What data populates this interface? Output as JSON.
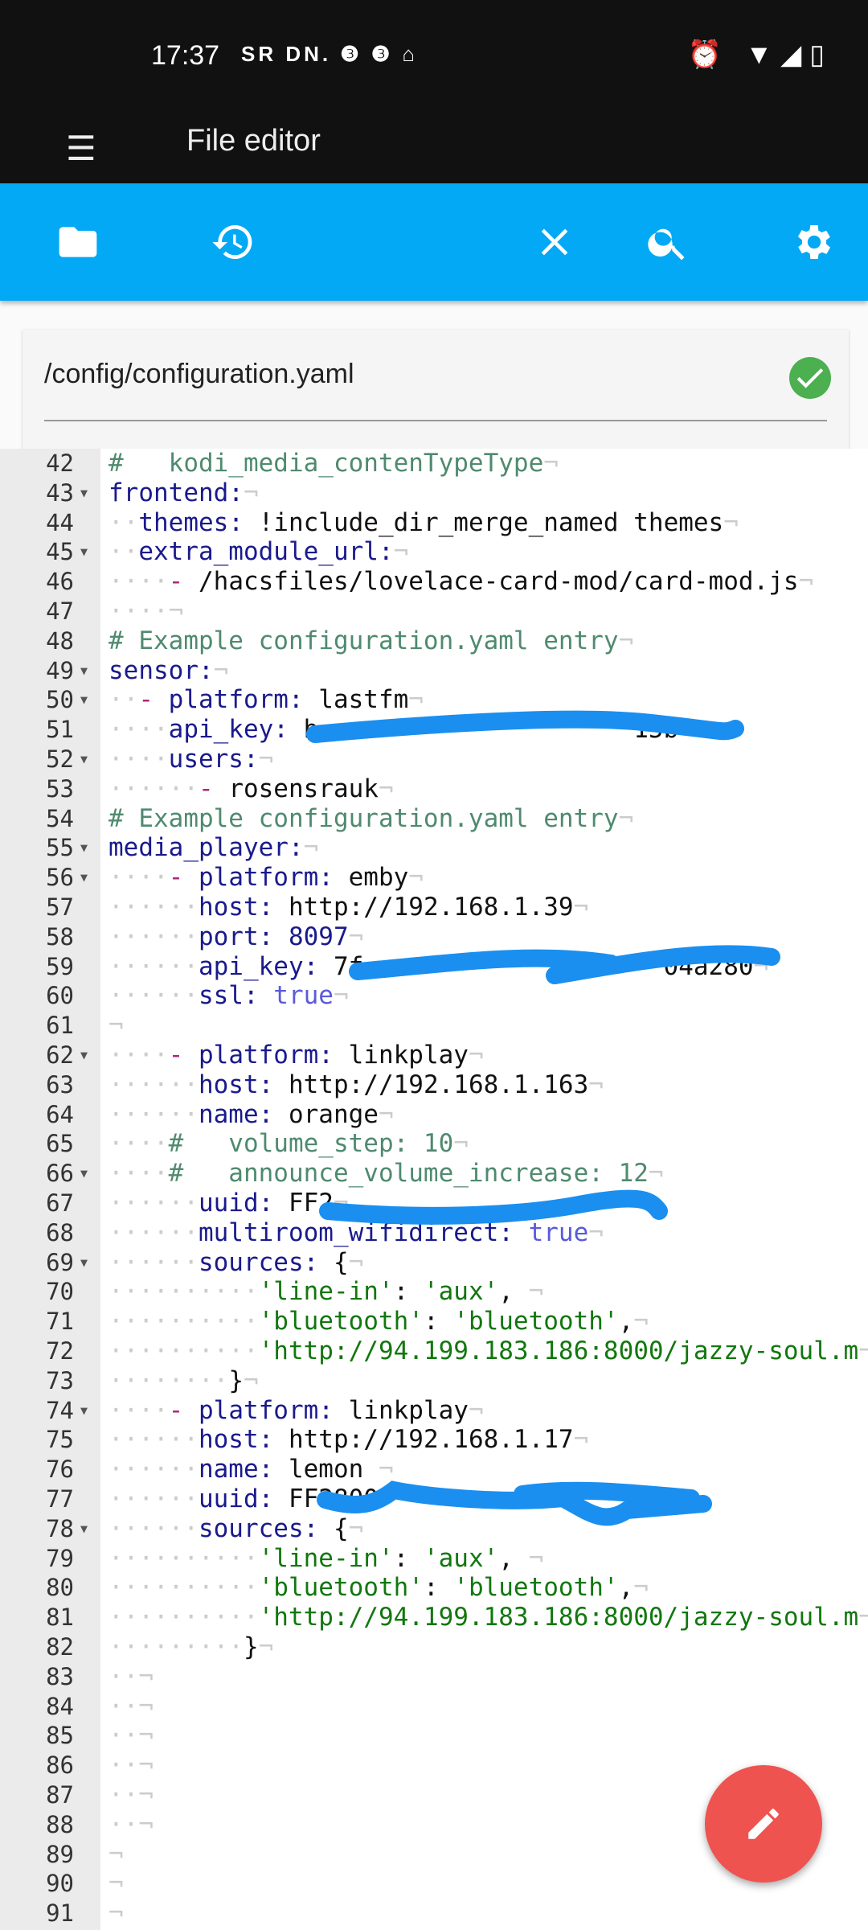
{
  "status": {
    "time": "17:37",
    "notifications": "SR DN. ❸ ❸ ⌂",
    "right_icons": "⏰ ▼◢▯"
  },
  "appbar": {
    "title": "File editor"
  },
  "toolbar": {
    "icons": [
      "folder-icon",
      "history-icon",
      "close-icon",
      "search-icon",
      "settings-icon"
    ]
  },
  "file": {
    "path": "/config/configuration.yaml",
    "status": "valid"
  },
  "colors": {
    "toolbar": "#03a9f4",
    "fab": "#ef5350",
    "ok": "#4caf50",
    "redaction": "#1a8ff0"
  },
  "lines": [
    {
      "n": "42",
      "f": 0,
      "t": [
        [
          "c",
          "#   kodi_media_contenTypeType"
        ]
      ]
    },
    {
      "n": "43",
      "f": 1,
      "t": [
        [
          "k",
          "frontend:"
        ]
      ]
    },
    {
      "n": "44",
      "f": 0,
      "t": [
        [
          "ws",
          "  "
        ],
        [
          "k",
          "themes:"
        ],
        [
          "v",
          " !include_dir_merge_named themes"
        ]
      ]
    },
    {
      "n": "45",
      "f": 1,
      "t": [
        [
          "ws",
          "  "
        ],
        [
          "k",
          "extra_module_url:"
        ]
      ]
    },
    {
      "n": "46",
      "f": 0,
      "t": [
        [
          "ws",
          "    "
        ],
        [
          "d",
          "-"
        ],
        [
          "v",
          " /hacsfiles/lovelace-card-mod/card-mod.js"
        ]
      ]
    },
    {
      "n": "47",
      "f": 0,
      "t": [
        [
          "ws",
          "····"
        ]
      ]
    },
    {
      "n": "48",
      "f": 0,
      "t": [
        [
          "c",
          "# Example configuration.yaml entry"
        ]
      ]
    },
    {
      "n": "49",
      "f": 1,
      "t": [
        [
          "k",
          "sensor:"
        ]
      ]
    },
    {
      "n": "50",
      "f": 1,
      "t": [
        [
          "ws",
          "  "
        ],
        [
          "d",
          "-"
        ],
        [
          "k",
          " platform:"
        ],
        [
          "v",
          " lastfm"
        ]
      ]
    },
    {
      "n": "51",
      "f": 0,
      "t": [
        [
          "ws",
          "    "
        ],
        [
          "k",
          "api_key:"
        ],
        [
          "v",
          " b                     15b"
        ]
      ]
    },
    {
      "n": "52",
      "f": 1,
      "t": [
        [
          "ws",
          "    "
        ],
        [
          "k",
          "users:"
        ]
      ]
    },
    {
      "n": "53",
      "f": 0,
      "t": [
        [
          "ws",
          "      "
        ],
        [
          "d",
          "-"
        ],
        [
          "v",
          " rosensrauk"
        ]
      ]
    },
    {
      "n": "54",
      "f": 0,
      "t": [
        [
          "c",
          "# Example configuration.yaml entry"
        ]
      ]
    },
    {
      "n": "55",
      "f": 1,
      "t": [
        [
          "k",
          "media_player:"
        ]
      ]
    },
    {
      "n": "56",
      "f": 1,
      "t": [
        [
          "ws",
          "    "
        ],
        [
          "d",
          "-"
        ],
        [
          "k",
          " platform:"
        ],
        [
          "v",
          " emby"
        ]
      ]
    },
    {
      "n": "57",
      "f": 0,
      "t": [
        [
          "ws",
          "      "
        ],
        [
          "k",
          "host:"
        ],
        [
          "v",
          " http://192.168.1.39"
        ]
      ]
    },
    {
      "n": "58",
      "f": 0,
      "t": [
        [
          "ws",
          "      "
        ],
        [
          "k",
          "port:"
        ],
        [
          "n",
          " 8097"
        ]
      ]
    },
    {
      "n": "59",
      "f": 0,
      "t": [
        [
          "ws",
          "      "
        ],
        [
          "k",
          "api_key:"
        ],
        [
          "v",
          " 7f                    04a280"
        ]
      ]
    },
    {
      "n": "60",
      "f": 0,
      "t": [
        [
          "ws",
          "      "
        ],
        [
          "k",
          "ssl:"
        ],
        [
          "b",
          " true"
        ]
      ]
    },
    {
      "n": "61",
      "f": 0,
      "t": []
    },
    {
      "n": "62",
      "f": 1,
      "t": [
        [
          "ws",
          "    "
        ],
        [
          "d",
          "-"
        ],
        [
          "k",
          " platform:"
        ],
        [
          "v",
          " linkplay"
        ]
      ]
    },
    {
      "n": "63",
      "f": 0,
      "t": [
        [
          "ws",
          "      "
        ],
        [
          "k",
          "host:"
        ],
        [
          "v",
          " http://192.168.1.163"
        ]
      ]
    },
    {
      "n": "64",
      "f": 0,
      "t": [
        [
          "ws",
          "      "
        ],
        [
          "k",
          "name:"
        ],
        [
          "v",
          " orange"
        ]
      ]
    },
    {
      "n": "65",
      "f": 0,
      "t": [
        [
          "ws",
          "    "
        ],
        [
          "c",
          "#   volume_step: 10"
        ]
      ]
    },
    {
      "n": "66",
      "f": 1,
      "t": [
        [
          "ws",
          "    "
        ],
        [
          "c",
          "#   announce_volume_increase: 12"
        ]
      ]
    },
    {
      "n": "67",
      "f": 0,
      "t": [
        [
          "ws",
          "      "
        ],
        [
          "k",
          "uuid:"
        ],
        [
          "v",
          " FF2"
        ]
      ]
    },
    {
      "n": "68",
      "f": 0,
      "t": [
        [
          "ws",
          "      "
        ],
        [
          "k",
          "multiroom_wifidirect:"
        ],
        [
          "b",
          " true"
        ]
      ]
    },
    {
      "n": "69",
      "f": 1,
      "t": [
        [
          "ws",
          "      "
        ],
        [
          "k",
          "sources:"
        ],
        [
          "v",
          " {"
        ]
      ]
    },
    {
      "n": "70",
      "f": 0,
      "t": [
        [
          "ws",
          "          "
        ],
        [
          "s",
          "'line-in'"
        ],
        [
          "v",
          ": "
        ],
        [
          "s",
          "'aux'"
        ],
        [
          "v",
          ", "
        ]
      ]
    },
    {
      "n": "71",
      "f": 0,
      "t": [
        [
          "ws",
          "          "
        ],
        [
          "s",
          "'bluetooth'"
        ],
        [
          "v",
          ": "
        ],
        [
          "s",
          "'bluetooth'"
        ],
        [
          "v",
          ","
        ]
      ]
    },
    {
      "n": "72",
      "f": 0,
      "t": [
        [
          "ws",
          "          "
        ],
        [
          "s",
          "'http://94.199.183.186:8000/jazzy-soul.m"
        ]
      ]
    },
    {
      "n": "73",
      "f": 0,
      "t": [
        [
          "ws",
          "        "
        ],
        [
          "v",
          "}"
        ]
      ]
    },
    {
      "n": "74",
      "f": 1,
      "t": [
        [
          "ws",
          "    "
        ],
        [
          "d",
          "-"
        ],
        [
          "k",
          " platform:"
        ],
        [
          "v",
          " linkplay"
        ]
      ]
    },
    {
      "n": "75",
      "f": 0,
      "t": [
        [
          "ws",
          "      "
        ],
        [
          "k",
          "host:"
        ],
        [
          "v",
          " http://192.168.1.17"
        ]
      ]
    },
    {
      "n": "76",
      "f": 0,
      "t": [
        [
          "ws",
          "      "
        ],
        [
          "k",
          "name:"
        ],
        [
          "v",
          " lemon "
        ]
      ]
    },
    {
      "n": "77",
      "f": 0,
      "t": [
        [
          "ws",
          "      "
        ],
        [
          "k",
          "uuid:"
        ],
        [
          "v",
          " FF2800"
        ]
      ]
    },
    {
      "n": "78",
      "f": 1,
      "t": [
        [
          "ws",
          "      "
        ],
        [
          "k",
          "sources:"
        ],
        [
          "v",
          " {"
        ]
      ]
    },
    {
      "n": "79",
      "f": 0,
      "t": [
        [
          "ws",
          "          "
        ],
        [
          "s",
          "'line-in'"
        ],
        [
          "v",
          ": "
        ],
        [
          "s",
          "'aux'"
        ],
        [
          "v",
          ", "
        ]
      ]
    },
    {
      "n": "80",
      "f": 0,
      "t": [
        [
          "ws",
          "          "
        ],
        [
          "s",
          "'bluetooth'"
        ],
        [
          "v",
          ": "
        ],
        [
          "s",
          "'bluetooth'"
        ],
        [
          "v",
          ","
        ]
      ]
    },
    {
      "n": "81",
      "f": 0,
      "t": [
        [
          "ws",
          "          "
        ],
        [
          "s",
          "'http://94.199.183.186:8000/jazzy-soul.m"
        ]
      ]
    },
    {
      "n": "82",
      "f": 0,
      "t": [
        [
          "ws",
          "         "
        ],
        [
          "v",
          "}"
        ]
      ]
    },
    {
      "n": "83",
      "f": 0,
      "t": [
        [
          "ws",
          "  "
        ]
      ]
    },
    {
      "n": "84",
      "f": 0,
      "t": [
        [
          "ws",
          "  "
        ]
      ]
    },
    {
      "n": "85",
      "f": 0,
      "t": [
        [
          "ws",
          "  "
        ]
      ]
    },
    {
      "n": "86",
      "f": 0,
      "t": [
        [
          "ws",
          "  "
        ]
      ]
    },
    {
      "n": "87",
      "f": 0,
      "t": [
        [
          "ws",
          "  "
        ]
      ]
    },
    {
      "n": "88",
      "f": 0,
      "t": [
        [
          "ws",
          "  "
        ]
      ]
    },
    {
      "n": "89",
      "f": 0,
      "t": []
    },
    {
      "n": "90",
      "f": 0,
      "t": []
    },
    {
      "n": "91",
      "f": 0,
      "t": []
    }
  ]
}
